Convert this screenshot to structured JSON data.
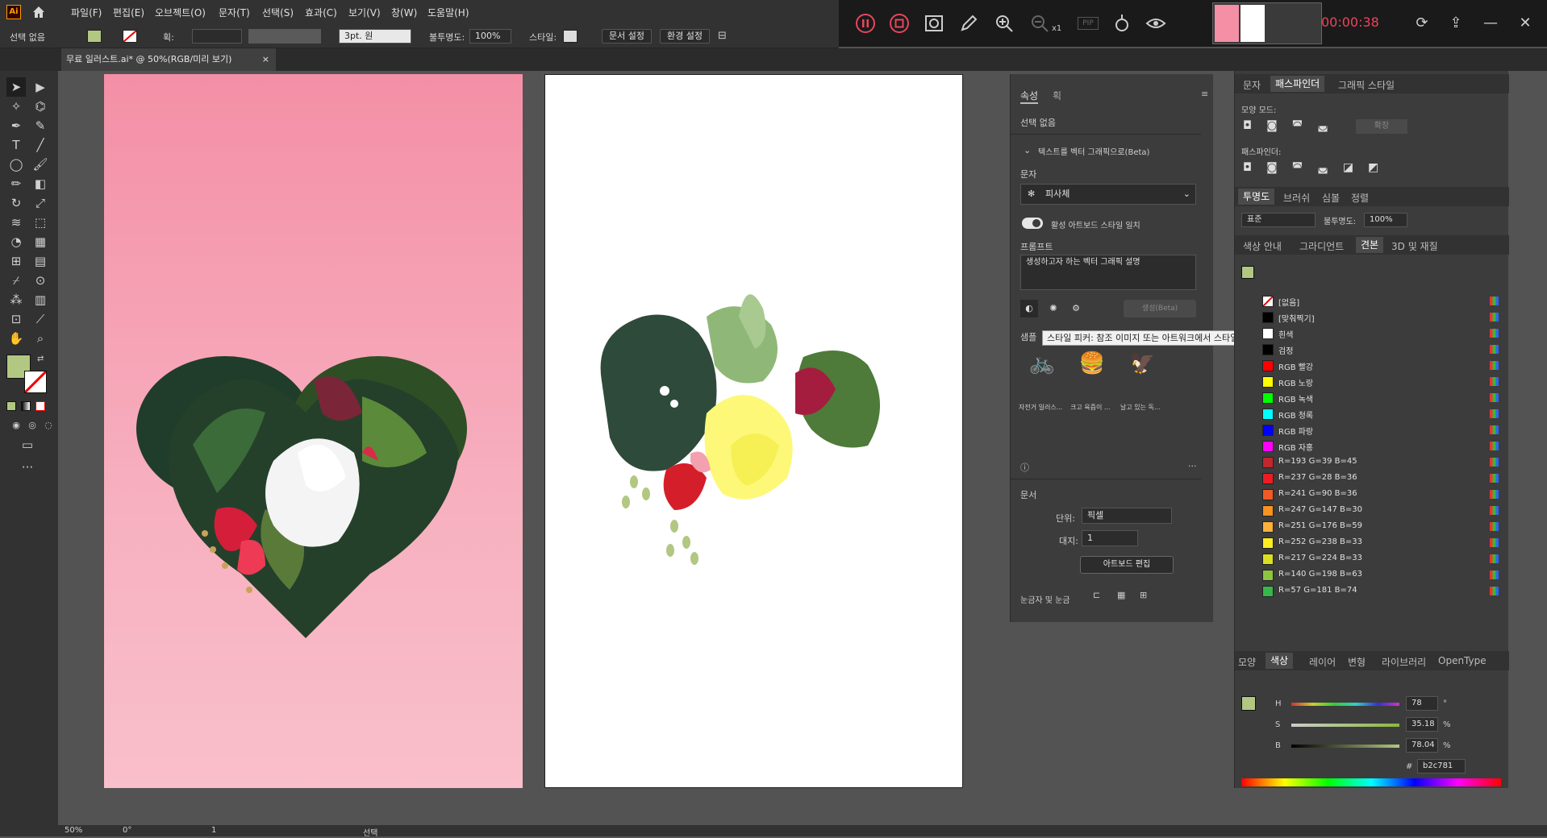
{
  "menubar": {
    "logo": "Ai",
    "items": [
      "파일(F)",
      "편집(E)",
      "오브젝트(O)",
      "문자(T)",
      "선택(S)",
      "효과(C)",
      "보기(V)",
      "창(W)",
      "도움말(H)"
    ]
  },
  "recorder": {
    "timer": "00:00:38",
    "speed": "x1",
    "pip_label": "PIP"
  },
  "controlbar": {
    "selection": "선택 없음",
    "stroke_label": "획:",
    "brush": "3pt. 원",
    "opacity_label": "불투명도:",
    "opacity": "100%",
    "style_label": "스타일:",
    "doc_setup": "문서 설정",
    "preferences": "환경 설정"
  },
  "tab": {
    "title": "무료 일러스트.ai* @ 50%(RGB/미리 보기)",
    "close": "×"
  },
  "properties": {
    "tabs": [
      "속성",
      "획"
    ],
    "no_selection": "선택 없음",
    "section_title": "텍스트를 벡터 그래픽으로(Beta)",
    "subject_label": "문자",
    "subject_value": "피사체",
    "toggle_label": "활성 아트보드 스타일 일치",
    "prompt_label": "프롬프트",
    "prompt_placeholder": "생성하고자 하는 벡터 그래픽 설명",
    "generate": "생성(Beta)",
    "samples_label": "샘플",
    "samples": [
      {
        "caption": "자전거 일러스...",
        "icon": "bicycle-icon"
      },
      {
        "caption": "크고 육즙이 ...",
        "icon": "burger-icon"
      },
      {
        "caption": "날고 있는 독...",
        "icon": "eagle-icon"
      }
    ],
    "tooltip": "스타일 피커: 참조 이미지 또는 아트워크에서 스타일 추출",
    "document_label": "문서",
    "units_label": "단위:",
    "units_value": "픽셀",
    "artboard_label": "대지:",
    "artboard_value": "1",
    "edit_artboard": "아트보드 편집",
    "rulers_label": "눈금자 및 눈금"
  },
  "right": {
    "top_tabs": [
      "문자",
      "패스파인더",
      "그래픽 스타일"
    ],
    "shape_modes": "모양 모드:",
    "expand": "확장",
    "pathfinder": "패스파인더:",
    "mid_tabs": [
      "투명도",
      "브러쉬",
      "심볼",
      "정렬"
    ],
    "blend_mode": "표준",
    "opacity_label": "불투명도:",
    "opacity": "100%",
    "swatch_tabs": [
      "색상 안내",
      "그라디언트",
      "견본",
      "3D 및 재질"
    ],
    "swatches": [
      {
        "label": "[없음]",
        "color": "none"
      },
      {
        "label": "[맞춰찍기]",
        "color": "#000000"
      },
      {
        "label": "흰색",
        "color": "#ffffff"
      },
      {
        "label": "검정",
        "color": "#000000"
      },
      {
        "label": "RGB 빨강",
        "color": "#ff0000"
      },
      {
        "label": "RGB 노랑",
        "color": "#ffff00"
      },
      {
        "label": "RGB 녹색",
        "color": "#00ff00"
      },
      {
        "label": "RGB 청록",
        "color": "#00ffff"
      },
      {
        "label": "RGB 파랑",
        "color": "#0000ff"
      },
      {
        "label": "RGB 자홍",
        "color": "#ff00ff"
      },
      {
        "label": "R=193 G=39 B=45",
        "color": "#c1272d"
      },
      {
        "label": "R=237 G=28 B=36",
        "color": "#ed1c24"
      },
      {
        "label": "R=241 G=90 B=36",
        "color": "#f15a24"
      },
      {
        "label": "R=247 G=147 B=30",
        "color": "#f7931e"
      },
      {
        "label": "R=251 G=176 B=59",
        "color": "#fbb03b"
      },
      {
        "label": "R=252 G=238 B=33",
        "color": "#fcee21"
      },
      {
        "label": "R=217 G=224 B=33",
        "color": "#d9e021"
      },
      {
        "label": "R=140 G=198 B=63",
        "color": "#8cc63f"
      },
      {
        "label": "R=57 G=181 B=74",
        "color": "#39b54a"
      }
    ],
    "color_tabs": [
      "모양",
      "색상",
      "레이어",
      "변형",
      "라이브러리",
      "OpenType"
    ],
    "h_label": "H",
    "h_value": "78",
    "h_unit": "°",
    "s_label": "S",
    "s_value": "35.18",
    "s_unit": "%",
    "b_label": "B",
    "b_value": "78.04",
    "b_unit": "%",
    "hex_label": "#",
    "hex_value": "b2c781",
    "fill_color": "#b2c781"
  },
  "status": {
    "zoom": "50%",
    "rotation": "0°",
    "artboard": "1",
    "tool": "선택"
  }
}
